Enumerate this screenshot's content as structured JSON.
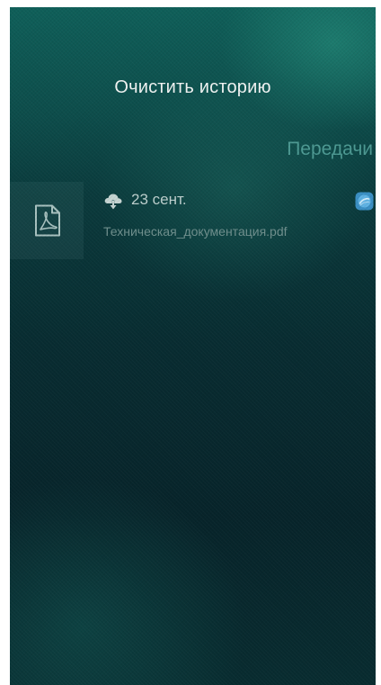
{
  "header": {
    "clear_history_label": "Очистить историю"
  },
  "section": {
    "title": "Передачи"
  },
  "transfers": [
    {
      "date": "23 сент.",
      "filename": "Техническая_документация.pdf",
      "direction_icon": "cloud-download-icon",
      "file_icon": "pdf-icon",
      "status_icon": "transfer-status-icon"
    }
  ],
  "colors": {
    "accent": "#4d9a93",
    "background_top": "#0f5f59",
    "background_bottom": "#07242a",
    "status_blue": "#4aa3d8"
  }
}
